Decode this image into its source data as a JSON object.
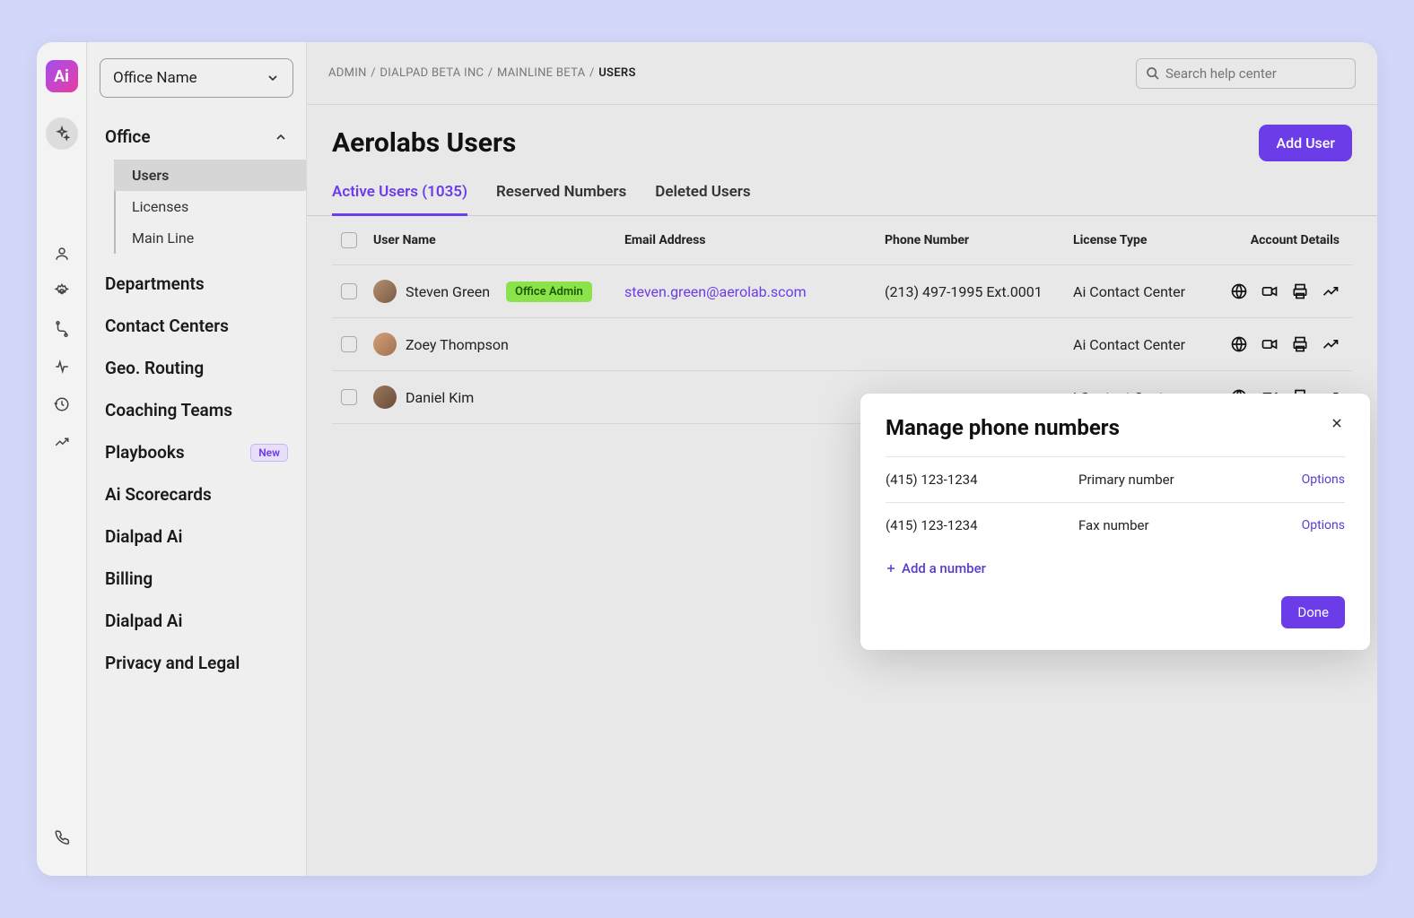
{
  "rail": {
    "logo_text": "Ai"
  },
  "sidebar": {
    "office_selector": "Office Name",
    "group_label": "Office",
    "sub_items": [
      "Users",
      "Licenses",
      "Main Line"
    ],
    "items": [
      {
        "label": "Departments"
      },
      {
        "label": "Contact Centers"
      },
      {
        "label": "Geo. Routing"
      },
      {
        "label": "Coaching Teams"
      },
      {
        "label": "Playbooks",
        "badge": "New"
      },
      {
        "label": "Ai Scorecards"
      },
      {
        "label": "Dialpad Ai"
      },
      {
        "label": "Billing"
      },
      {
        "label": "Dialpad Ai"
      },
      {
        "label": "Privacy and Legal"
      }
    ]
  },
  "breadcrumb": {
    "segments": [
      "ADMIN",
      "DIALPAD BETA INC",
      "MAINLINE BETA"
    ],
    "current": "USERS"
  },
  "search": {
    "placeholder": "Search help center"
  },
  "page": {
    "title": "Aerolabs Users",
    "add_button": "Add User"
  },
  "tabs": [
    {
      "label": "Active Users (1035)",
      "active": true
    },
    {
      "label": "Reserved Numbers",
      "active": false
    },
    {
      "label": "Deleted Users",
      "active": false
    }
  ],
  "table": {
    "headers": [
      "User Name",
      "Email Address",
      "Phone Number",
      "License Type",
      "Account Details"
    ],
    "rows": [
      {
        "name": "Steven Green",
        "chip": "Office Admin",
        "email": "steven.green@aerolab.scom",
        "phone": "(213) 497-1995 Ext.0001",
        "license": "Ai Contact Center"
      },
      {
        "name": "Zoey Thompson",
        "chip": "",
        "email": "",
        "phone": "",
        "license": "Ai Contact Center"
      },
      {
        "name": "Daniel Kim",
        "chip": "",
        "email": "",
        "phone": "",
        "license": "i Contact Center"
      }
    ]
  },
  "modal": {
    "title": "Manage phone numbers",
    "rows": [
      {
        "number": "(415) 123-1234",
        "type": "Primary number",
        "opt": "Options"
      },
      {
        "number": "(415) 123-1234",
        "type": "Fax number",
        "opt": "Options"
      }
    ],
    "add": "Add a number",
    "done": "Done"
  }
}
